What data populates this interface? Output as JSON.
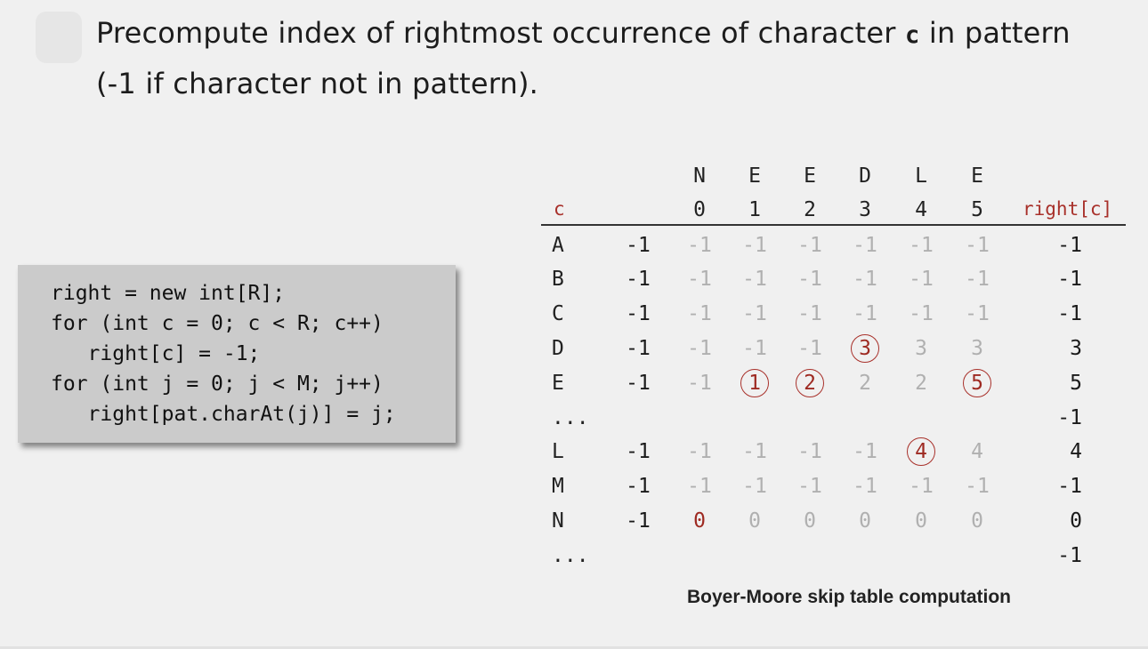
{
  "heading": {
    "line1_pre": "Precompute index of rightmost occurrence of character ",
    "line1_code": "c",
    "line1_post": " in pattern",
    "line2": "(-1 if character not in pattern)."
  },
  "code": [
    "right = new int[R];",
    "for (int c = 0; c < R; c++)",
    "   right[c] = -1;",
    "for (int j = 0; j < M; j++)",
    "   right[pat.charAt(j)] = j;"
  ],
  "table": {
    "char_col_label": "c",
    "result_col_label": "right[c]",
    "pattern_chars": [
      "N",
      "E",
      "E",
      "D",
      "L",
      "E"
    ],
    "pattern_indices": [
      "0",
      "1",
      "2",
      "3",
      "4",
      "5"
    ],
    "rows": [
      {
        "label": "A",
        "init": "-1",
        "cells": [
          "-1",
          "-1",
          "-1",
          "-1",
          "-1",
          "-1"
        ],
        "highlight": [],
        "right": "-1"
      },
      {
        "label": "B",
        "init": "-1",
        "cells": [
          "-1",
          "-1",
          "-1",
          "-1",
          "-1",
          "-1"
        ],
        "highlight": [],
        "right": "-1"
      },
      {
        "label": "C",
        "init": "-1",
        "cells": [
          "-1",
          "-1",
          "-1",
          "-1",
          "-1",
          "-1"
        ],
        "highlight": [],
        "right": "-1"
      },
      {
        "label": "D",
        "init": "-1",
        "cells": [
          "-1",
          "-1",
          "-1",
          "3",
          "3",
          "3"
        ],
        "highlight": [
          3
        ],
        "right": "3"
      },
      {
        "label": "E",
        "init": "-1",
        "cells": [
          "-1",
          "1",
          "2",
          "2",
          "2",
          "5"
        ],
        "highlight": [
          1,
          2,
          5
        ],
        "right": "5"
      },
      {
        "label": "...",
        "init": "",
        "cells": [
          "",
          "",
          "",
          "",
          "",
          ""
        ],
        "highlight": [],
        "right": "-1"
      },
      {
        "label": "L",
        "init": "-1",
        "cells": [
          "-1",
          "-1",
          "-1",
          "-1",
          "4",
          "4"
        ],
        "highlight": [
          4
        ],
        "right": "4"
      },
      {
        "label": "M",
        "init": "-1",
        "cells": [
          "-1",
          "-1",
          "-1",
          "-1",
          "-1",
          "-1"
        ],
        "highlight": [],
        "right": "-1"
      },
      {
        "label": "N",
        "init": "-1",
        "cells": [
          "0",
          "0",
          "0",
          "0",
          "0",
          "0"
        ],
        "highlight": [
          0
        ],
        "highlight_style": "red-text",
        "right": "0"
      },
      {
        "label": "...",
        "init": "",
        "cells": [
          "",
          "",
          "",
          "",
          "",
          ""
        ],
        "highlight": [],
        "right": "-1"
      }
    ]
  },
  "caption": "Boyer-Moore skip table computation",
  "colors": {
    "accent_red": "#a8302a",
    "faded": "#b0b0b0",
    "code_box_bg": "#cbcbcb",
    "background": "#f0f0f0"
  }
}
